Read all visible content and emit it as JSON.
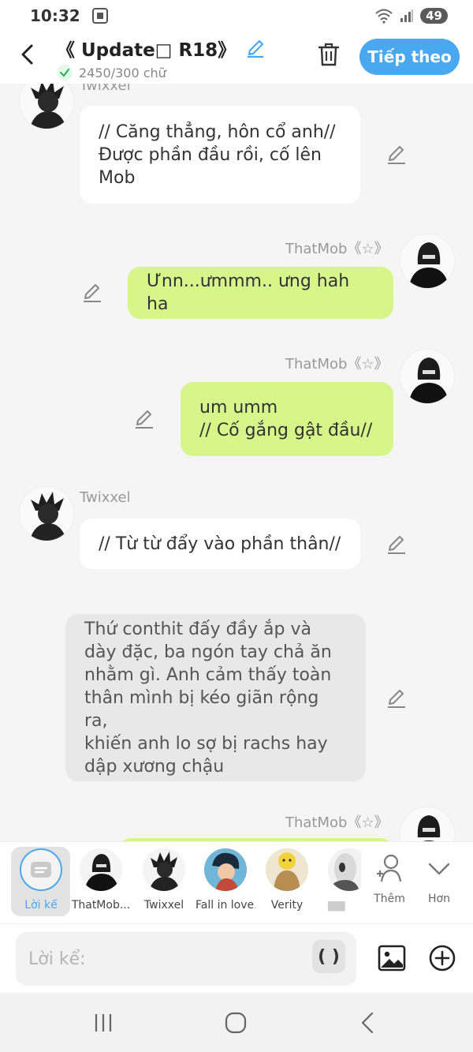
{
  "status": {
    "time": "10:32",
    "battery": "49"
  },
  "header": {
    "title": "《 Update□ R18》",
    "word_count": "2450/300 chữ",
    "next_label": "Tiếp theo"
  },
  "messages": [
    {
      "sender": "Twixxel",
      "text": "// Căng thẳng, hôn cổ anh//\nĐược phần đầu rồi, cố lên\nMob"
    },
    {
      "sender": "ThatMob《☆》",
      "text": "Ưnn...ưmmm.. ưng hah ha"
    },
    {
      "sender": "ThatMob《☆》",
      "text": "um umm\n// Cố gắng gật đầu//"
    },
    {
      "sender": "Twixxel",
      "text": "// Từ từ đẩy vào phần thân//"
    },
    {
      "sender": "",
      "text": "Thứ conthit đấy đầy ắp và\ndày đặc, ba ngón tay chả ăn\nnhằm gì. Anh cảm thấy toàn\nthân mình bị kéo giãn rộng ra,\nkhiến anh lo sợ bị rachs hay\ndập xương chậu"
    },
    {
      "sender": "ThatMob《☆》",
      "text": ""
    }
  ],
  "characters": [
    {
      "label": "Lời kể"
    },
    {
      "label": "ThatMob..."
    },
    {
      "label": "Twixxel"
    },
    {
      "label": "Fall in love..."
    },
    {
      "label": "Verity"
    },
    {
      "label": "▆▆"
    }
  ],
  "actions": {
    "more_chars": "Thêm",
    "expand": "Hơn"
  },
  "input": {
    "placeholder": "Lời kể:",
    "paren": "( )"
  },
  "colors": {
    "accent": "#4aa8f0",
    "user_bubble": "#d6f58a",
    "narration": "#e8e8e8"
  }
}
